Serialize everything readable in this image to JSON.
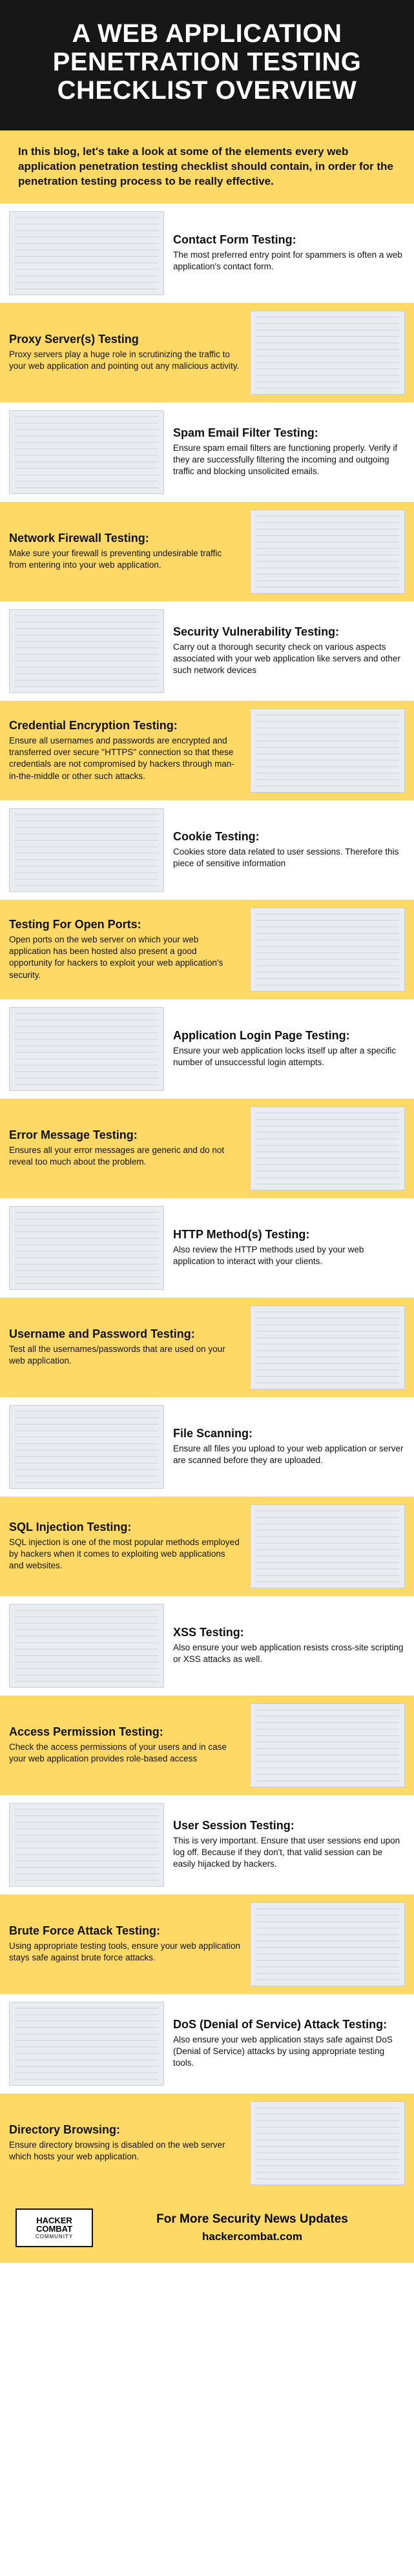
{
  "header": {
    "title": "A WEB APPLICATION PENETRATION TESTING CHECKLIST OVERVIEW"
  },
  "intro": {
    "text": "In this blog, let's take a look at some of the elements every web application penetration testing checklist should contain, in order for the penetration testing process to be really effective."
  },
  "sections": [
    {
      "title": "Contact Form Testing:",
      "desc": "The most preferred entry point for spammers is often a web application's contact form."
    },
    {
      "title": "Proxy Server(s) Testing",
      "desc": "Proxy servers play a huge role in scrutinizing the traffic to your web application and pointing out any malicious activity."
    },
    {
      "title": "Spam Email Filter Testing:",
      "desc": "Ensure spam email filters are functioning properly. Verify if they are successfully filtering the incoming and outgoing traffic and blocking unsolicited emails."
    },
    {
      "title": "Network Firewall Testing:",
      "desc": "Make sure your firewall is preventing undesirable traffic from entering into your web application."
    },
    {
      "title": "Security Vulnerability Testing:",
      "desc": "Carry out a thorough security check on various aspects associated with your web application like servers and other such network devices"
    },
    {
      "title": "Credential Encryption Testing:",
      "desc": "Ensure all usernames and passwords are encrypted and transferred over secure \"HTTPS\" connection so that these credentials are not compromised by hackers through man-in-the-middle or other such attacks."
    },
    {
      "title": "Cookie Testing:",
      "desc": "Cookies store data related to user sessions. Therefore this piece of sensitive information"
    },
    {
      "title": "Testing For Open Ports:",
      "desc": "Open ports on the web server on which your web application has been hosted also present a good opportunity for hackers to exploit your web application's security."
    },
    {
      "title": "Application Login Page Testing:",
      "desc": "Ensure your web application locks itself up after a specific number of unsuccessful login attempts."
    },
    {
      "title": "Error Message Testing:",
      "desc": "Ensures all your error messages are generic and do not reveal too much about the problem."
    },
    {
      "title": "HTTP Method(s) Testing:",
      "desc": "Also review the HTTP methods used by your web application to interact with your clients."
    },
    {
      "title": "Username and Password Testing:",
      "desc": "Test all the usernames/passwords that are used on your web application."
    },
    {
      "title": "File Scanning:",
      "desc": "Ensure all files you upload to your web application or server are scanned before they are uploaded."
    },
    {
      "title": "SQL Injection Testing:",
      "desc": "SQL injection is one of the most popular methods employed by hackers when it comes to exploiting web applications and websites."
    },
    {
      "title": "XSS Testing:",
      "desc": "Also ensure your web application resists cross-site scripting or XSS attacks as well."
    },
    {
      "title": "Access Permission Testing:",
      "desc": "Check the access permissions of your users and in case your web application provides role-based access"
    },
    {
      "title": "User Session Testing:",
      "desc": "This is very important. Ensure that user sessions end upon log off. Because if they don't, that valid session can be easily hijacked by hackers."
    },
    {
      "title": "Brute Force Attack Testing:",
      "desc": "Using appropriate testing tools, ensure your web application stays safe against brute force attacks."
    },
    {
      "title": "DoS (Denial of Service) Attack Testing:",
      "desc": "Also ensure your web application stays safe against DoS (Denial of Service) attacks by using appropriate testing tools."
    },
    {
      "title": "Directory Browsing:",
      "desc": "Ensure directory browsing is disabled on the web server which hosts your web application."
    }
  ],
  "footer": {
    "logo_top": "HACKER",
    "logo_bottom": "COMBAT",
    "logo_tag": "COMMUNITY",
    "line1": "For More Security News Updates",
    "line2": "hackercombat.com"
  }
}
